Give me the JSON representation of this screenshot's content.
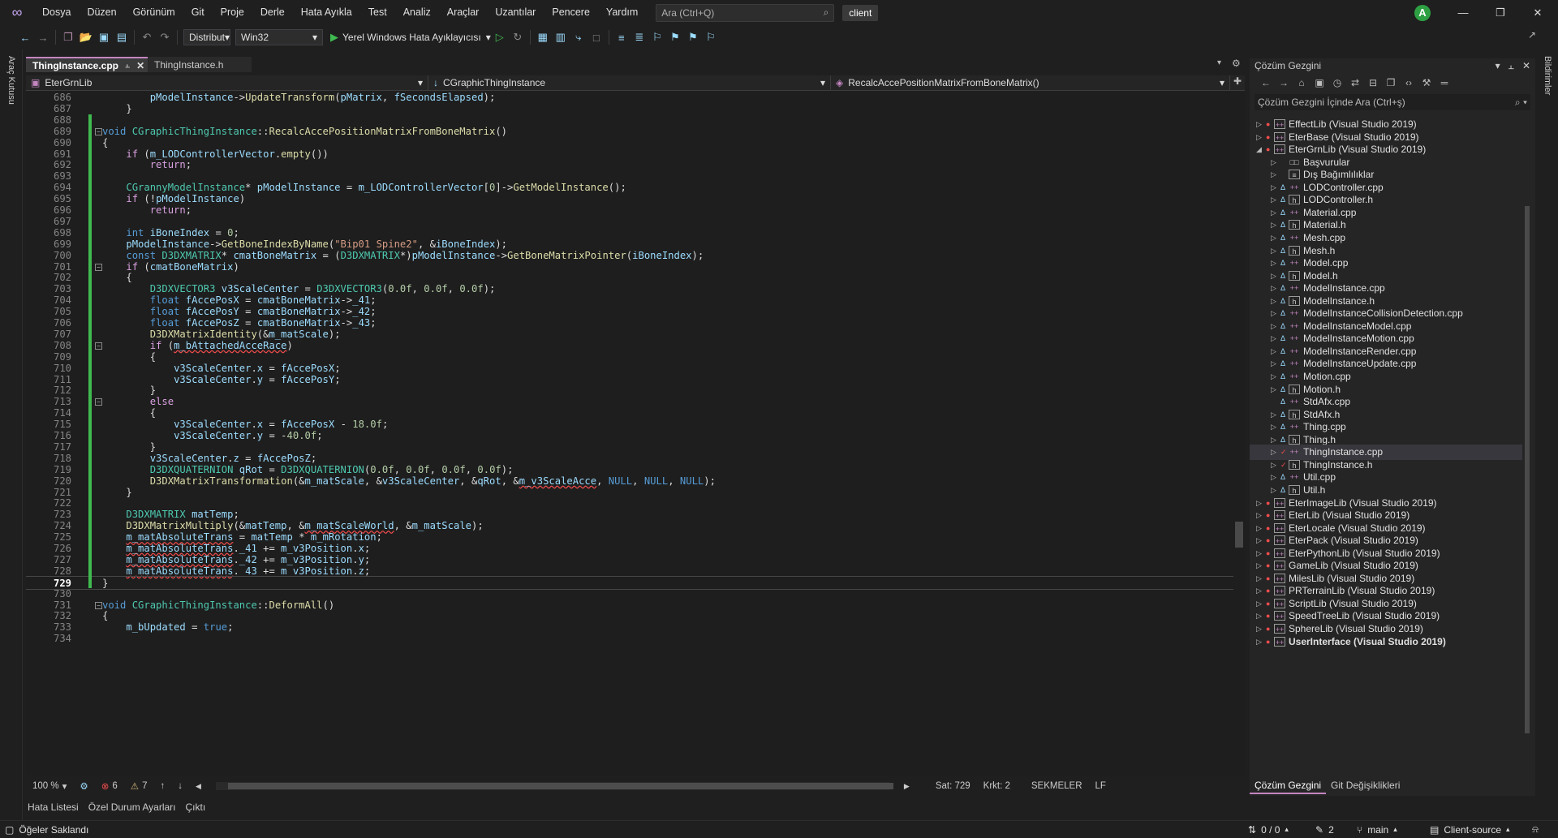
{
  "menubar": {
    "items": [
      "Dosya",
      "Düzen",
      "Görünüm",
      "Git",
      "Proje",
      "Derle",
      "Hata Ayıkla",
      "Test",
      "Analiz",
      "Araçlar",
      "Uzantılar",
      "Pencere",
      "Yardım"
    ],
    "search_placeholder": "Ara (Ctrl+Q)",
    "solution_name": "client",
    "avatar_letter": "A"
  },
  "toolbar": {
    "configuration": "Distribut",
    "platform": "Win32",
    "run_label": "Yerel Windows Hata Ayıklayıcısı"
  },
  "left_strip_label": "Araç Kutusu",
  "right_strip_label": "Bildirimler",
  "doc_tabs": [
    {
      "label": "ThingInstance.cpp",
      "active": true
    },
    {
      "label": "ThingInstance.h",
      "active": false
    }
  ],
  "navbar": {
    "project": "EterGrnLib",
    "scope": "CGraphicThingInstance",
    "member": "RecalcAccePositionMatrixFromBoneMatrix()"
  },
  "editor": {
    "current_line": "729",
    "lines": [
      {
        "n": "686",
        "t": "        pModelInstance->UpdateTransform(pMatrix, fSecondsElapsed);"
      },
      {
        "n": "687",
        "t": "    }"
      },
      {
        "n": "688",
        "t": ""
      },
      {
        "n": "689",
        "t": "void CGraphicThingInstance::RecalcAccePositionMatrixFromBoneMatrix()"
      },
      {
        "n": "690",
        "t": "{"
      },
      {
        "n": "691",
        "t": "    if (m_LODControllerVector.empty())"
      },
      {
        "n": "692",
        "t": "        return;"
      },
      {
        "n": "693",
        "t": ""
      },
      {
        "n": "694",
        "t": "    CGrannyModelInstance* pModelInstance = m_LODControllerVector[0]->GetModelInstance();"
      },
      {
        "n": "695",
        "t": "    if (!pModelInstance)"
      },
      {
        "n": "696",
        "t": "        return;"
      },
      {
        "n": "697",
        "t": ""
      },
      {
        "n": "698",
        "t": "    int iBoneIndex = 0;"
      },
      {
        "n": "699",
        "t": "    pModelInstance->GetBoneIndexByName(\"Bip01 Spine2\", &iBoneIndex);"
      },
      {
        "n": "700",
        "t": "    const D3DXMATRIX* cmatBoneMatrix = (D3DXMATRIX*)pModelInstance->GetBoneMatrixPointer(iBoneIndex);"
      },
      {
        "n": "701",
        "t": "    if (cmatBoneMatrix)"
      },
      {
        "n": "702",
        "t": "    {"
      },
      {
        "n": "703",
        "t": "        D3DXVECTOR3 v3ScaleCenter = D3DXVECTOR3(0.0f, 0.0f, 0.0f);"
      },
      {
        "n": "704",
        "t": "        float fAccePosX = cmatBoneMatrix->_41;"
      },
      {
        "n": "705",
        "t": "        float fAccePosY = cmatBoneMatrix->_42;"
      },
      {
        "n": "706",
        "t": "        float fAccePosZ = cmatBoneMatrix->_43;"
      },
      {
        "n": "707",
        "t": "        D3DXMatrixIdentity(&m_matScale);"
      },
      {
        "n": "708",
        "t": "        if (m_bAttachedAcceRace)"
      },
      {
        "n": "709",
        "t": "        {"
      },
      {
        "n": "710",
        "t": "            v3ScaleCenter.x = fAccePosX;"
      },
      {
        "n": "711",
        "t": "            v3ScaleCenter.y = fAccePosY;"
      },
      {
        "n": "712",
        "t": "        }"
      },
      {
        "n": "713",
        "t": "        else"
      },
      {
        "n": "714",
        "t": "        {"
      },
      {
        "n": "715",
        "t": "            v3ScaleCenter.x = fAccePosX - 18.0f;"
      },
      {
        "n": "716",
        "t": "            v3ScaleCenter.y = -40.0f;"
      },
      {
        "n": "717",
        "t": "        }"
      },
      {
        "n": "718",
        "t": "        v3ScaleCenter.z = fAccePosZ;"
      },
      {
        "n": "719",
        "t": "        D3DXQUATERNION qRot = D3DXQUATERNION(0.0f, 0.0f, 0.0f, 0.0f);"
      },
      {
        "n": "720",
        "t": "        D3DXMatrixTransformation(&m_matScale, &v3ScaleCenter, &qRot, &m_v3ScaleAcce, NULL, NULL, NULL);"
      },
      {
        "n": "721",
        "t": "    }"
      },
      {
        "n": "722",
        "t": ""
      },
      {
        "n": "723",
        "t": "    D3DXMATRIX matTemp;"
      },
      {
        "n": "724",
        "t": "    D3DXMatrixMultiply(&matTemp, &m_matScaleWorld, &m_matScale);"
      },
      {
        "n": "725",
        "t": "    m_matAbsoluteTrans = matTemp * m_mRotation;"
      },
      {
        "n": "726",
        "t": "    m_matAbsoluteTrans._41 += m_v3Position.x;"
      },
      {
        "n": "727",
        "t": "    m_matAbsoluteTrans._42 += m_v3Position.y;"
      },
      {
        "n": "728",
        "t": "    m_matAbsoluteTrans._43 += m_v3Position.z;"
      },
      {
        "n": "729",
        "t": "}"
      },
      {
        "n": "730",
        "t": ""
      },
      {
        "n": "731",
        "t": "void CGraphicThingInstance::DeformAll()"
      },
      {
        "n": "732",
        "t": "{"
      },
      {
        "n": "733",
        "t": "    m_bUpdated = true;"
      },
      {
        "n": "734",
        "t": ""
      }
    ]
  },
  "editor_status": {
    "zoom": "100 %",
    "errors": "6",
    "warnings": "7",
    "line": "Sat: 729",
    "col": "Krkt: 2",
    "indent": "SEKMELER",
    "eol": "LF"
  },
  "bottom_tabs": [
    "Hata Listesi",
    "Özel Durum Ayarları",
    "Çıktı"
  ],
  "statusbar": {
    "message": "Öğeler Saklandı",
    "updown": "0 / 0",
    "edits": "2",
    "branch": "main",
    "repo": "Client-source"
  },
  "solution_explorer": {
    "title": "Çözüm Gezgini",
    "search_placeholder": "Çözüm Gezgini İçinde Ara (Ctrl+ş)",
    "footer_tabs": [
      "Çözüm Gezgini",
      "Git Değişiklikleri"
    ],
    "nodes": [
      {
        "label": "EffectLib (Visual Studio 2019)",
        "kind": "proj",
        "level": 0,
        "arrow": "right"
      },
      {
        "label": "EterBase (Visual Studio 2019)",
        "kind": "proj",
        "level": 0,
        "arrow": "right"
      },
      {
        "label": "EterGrnLib (Visual Studio 2019)",
        "kind": "proj",
        "level": 0,
        "arrow": "down"
      },
      {
        "label": "Başvurular",
        "kind": "ref",
        "level": 1,
        "arrow": "right"
      },
      {
        "label": "Dış Bağımlılıklar",
        "kind": "ext",
        "level": 1,
        "arrow": "right"
      },
      {
        "label": "LODController.cpp",
        "kind": "cpp",
        "level": 1,
        "arrow": "right"
      },
      {
        "label": "LODController.h",
        "kind": "h",
        "level": 1,
        "arrow": "right"
      },
      {
        "label": "Material.cpp",
        "kind": "cpp",
        "level": 1,
        "arrow": "right"
      },
      {
        "label": "Material.h",
        "kind": "h",
        "level": 1,
        "arrow": "right"
      },
      {
        "label": "Mesh.cpp",
        "kind": "cpp",
        "level": 1,
        "arrow": "right"
      },
      {
        "label": "Mesh.h",
        "kind": "h",
        "level": 1,
        "arrow": "right"
      },
      {
        "label": "Model.cpp",
        "kind": "cpp",
        "level": 1,
        "arrow": "right"
      },
      {
        "label": "Model.h",
        "kind": "h",
        "level": 1,
        "arrow": "right"
      },
      {
        "label": "ModelInstance.cpp",
        "kind": "cpp",
        "level": 1,
        "arrow": "right"
      },
      {
        "label": "ModelInstance.h",
        "kind": "h",
        "level": 1,
        "arrow": "right"
      },
      {
        "label": "ModelInstanceCollisionDetection.cpp",
        "kind": "cpp",
        "level": 1,
        "arrow": "right"
      },
      {
        "label": "ModelInstanceModel.cpp",
        "kind": "cpp",
        "level": 1,
        "arrow": "right"
      },
      {
        "label": "ModelInstanceMotion.cpp",
        "kind": "cpp",
        "level": 1,
        "arrow": "right"
      },
      {
        "label": "ModelInstanceRender.cpp",
        "kind": "cpp",
        "level": 1,
        "arrow": "right"
      },
      {
        "label": "ModelInstanceUpdate.cpp",
        "kind": "cpp",
        "level": 1,
        "arrow": "right"
      },
      {
        "label": "Motion.cpp",
        "kind": "cpp",
        "level": 1,
        "arrow": "right"
      },
      {
        "label": "Motion.h",
        "kind": "h",
        "level": 1,
        "arrow": "right"
      },
      {
        "label": "StdAfx.cpp",
        "kind": "cpp",
        "level": 1,
        "arrow": "none"
      },
      {
        "label": "StdAfx.h",
        "kind": "h",
        "level": 1,
        "arrow": "right"
      },
      {
        "label": "Thing.cpp",
        "kind": "cpp",
        "level": 1,
        "arrow": "right"
      },
      {
        "label": "Thing.h",
        "kind": "h",
        "level": 1,
        "arrow": "right"
      },
      {
        "label": "ThingInstance.cpp",
        "kind": "cpp",
        "level": 1,
        "arrow": "right",
        "selected": true,
        "modified": true
      },
      {
        "label": "ThingInstance.h",
        "kind": "h",
        "level": 1,
        "arrow": "right",
        "modified": true
      },
      {
        "label": "Util.cpp",
        "kind": "cpp",
        "level": 1,
        "arrow": "right"
      },
      {
        "label": "Util.h",
        "kind": "h",
        "level": 1,
        "arrow": "right"
      },
      {
        "label": "EterImageLib (Visual Studio 2019)",
        "kind": "proj",
        "level": 0,
        "arrow": "right"
      },
      {
        "label": "EterLib (Visual Studio 2019)",
        "kind": "proj",
        "level": 0,
        "arrow": "right"
      },
      {
        "label": "EterLocale (Visual Studio 2019)",
        "kind": "proj",
        "level": 0,
        "arrow": "right"
      },
      {
        "label": "EterPack (Visual Studio 2019)",
        "kind": "proj",
        "level": 0,
        "arrow": "right"
      },
      {
        "label": "EterPythonLib (Visual Studio 2019)",
        "kind": "proj",
        "level": 0,
        "arrow": "right"
      },
      {
        "label": "GameLib (Visual Studio 2019)",
        "kind": "proj",
        "level": 0,
        "arrow": "right"
      },
      {
        "label": "MilesLib (Visual Studio 2019)",
        "kind": "proj",
        "level": 0,
        "arrow": "right"
      },
      {
        "label": "PRTerrainLib (Visual Studio 2019)",
        "kind": "proj",
        "level": 0,
        "arrow": "right"
      },
      {
        "label": "ScriptLib (Visual Studio 2019)",
        "kind": "proj",
        "level": 0,
        "arrow": "right"
      },
      {
        "label": "SpeedTreeLib (Visual Studio 2019)",
        "kind": "proj",
        "level": 0,
        "arrow": "right"
      },
      {
        "label": "SphereLib (Visual Studio 2019)",
        "kind": "proj",
        "level": 0,
        "arrow": "right"
      },
      {
        "label": "UserInterface (Visual Studio 2019)",
        "kind": "proj",
        "level": 0,
        "arrow": "right",
        "bold": true
      }
    ]
  }
}
